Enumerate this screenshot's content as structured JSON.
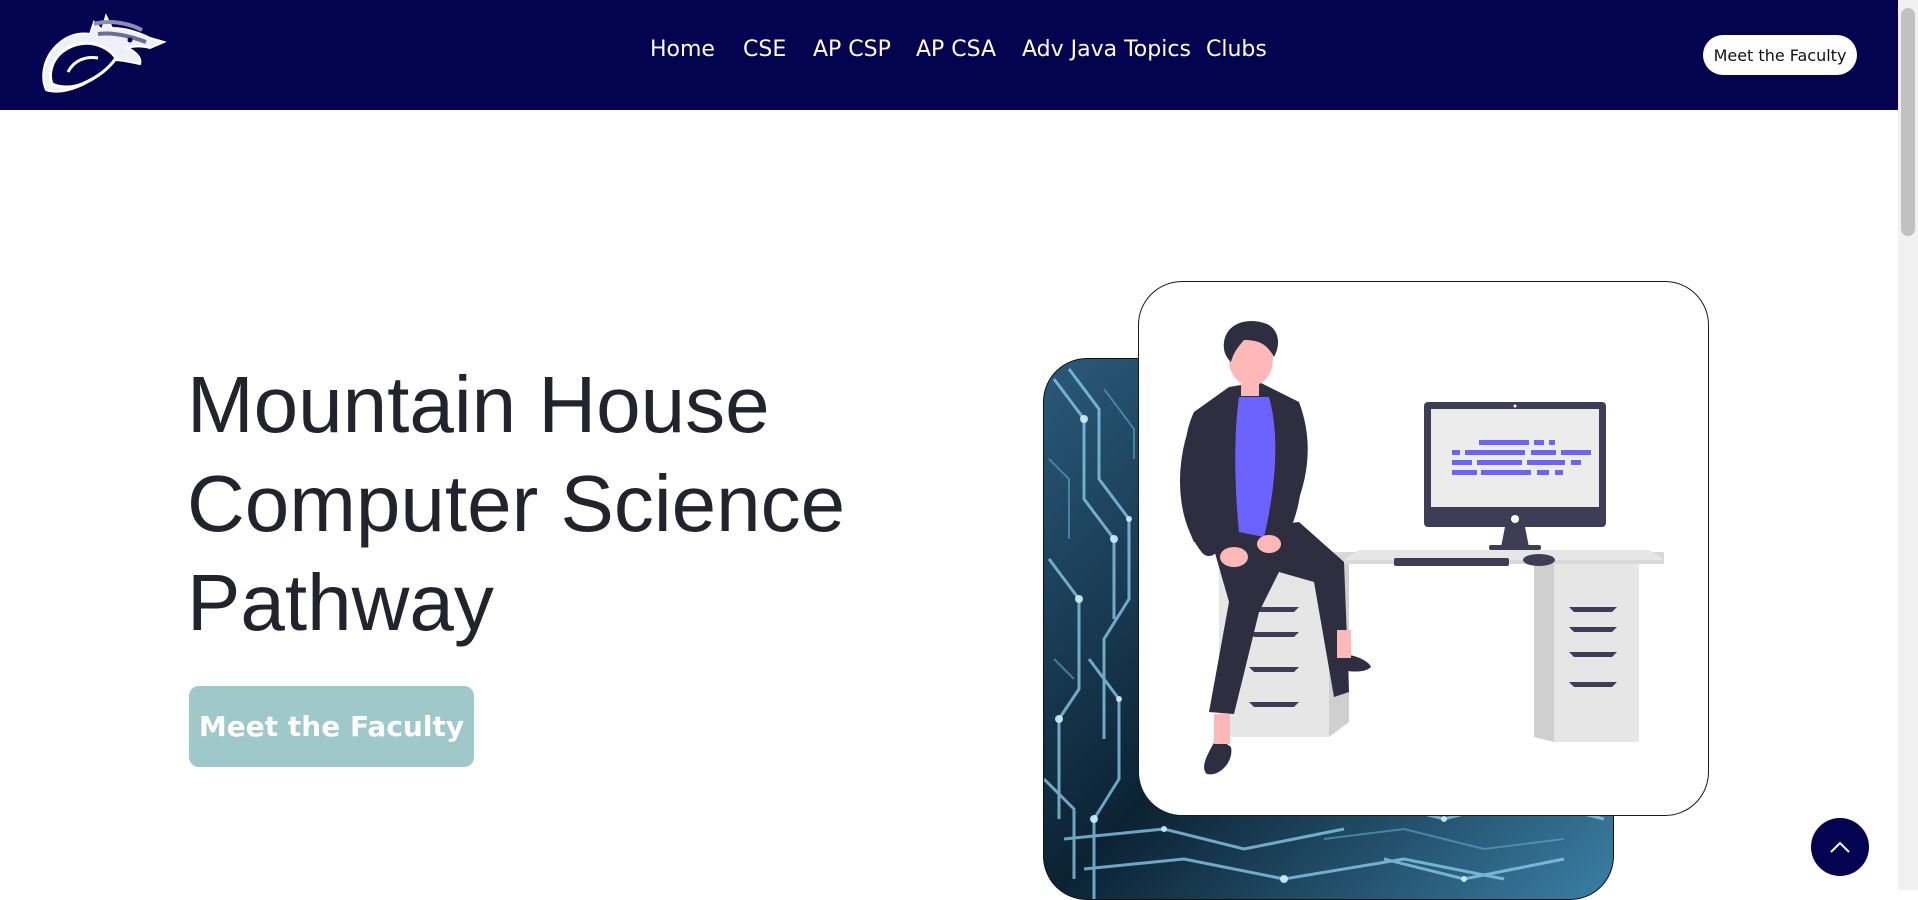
{
  "navbar": {
    "links": [
      {
        "label": "Home"
      },
      {
        "label": "CSE"
      },
      {
        "label": "AP CSP"
      },
      {
        "label": "AP CSA"
      },
      {
        "label": "Adv Java Topics"
      },
      {
        "label": "Clubs"
      }
    ],
    "cta_label": "Meet the Faculty",
    "logo_icon": "horse-mascot-logo-icon"
  },
  "hero": {
    "title_lines": [
      "Mountain House",
      "Computer Science",
      "Pathway"
    ],
    "button_label": "Meet the Faculty",
    "back_image": "circuit-board-image",
    "front_image": "person-at-desk-illustration"
  },
  "scroll_top_icon": "chevron-up-icon",
  "colors": {
    "navbar_bg": "#03034f",
    "hero_button_bg": "#9ec8c9",
    "title_text": "#23232d",
    "illustration_accent": "#6c63ff"
  }
}
